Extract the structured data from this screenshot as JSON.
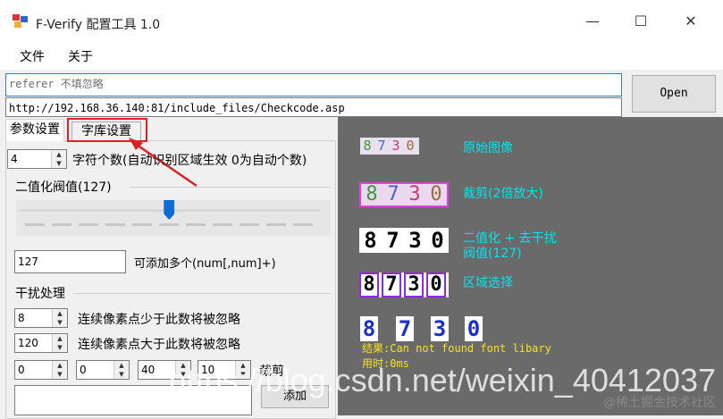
{
  "window": {
    "title": "F-Verify 配置工具 1.0",
    "min_glyph": "—",
    "max_glyph": "☐",
    "close_glyph": "✕"
  },
  "menu": {
    "items": [
      "文件",
      "关于"
    ]
  },
  "inputs": {
    "referer_value": "referer 不填忽略",
    "url_value": "http://192.168.36.140:81/include_files/Checkcode.asp",
    "open_label": "Open"
  },
  "tabs": [
    "参数设置",
    "字库设置"
  ],
  "params": {
    "char_count_value": "4",
    "char_count_label": "字符个数(自动识别区域生效 0为自动个数)",
    "binarize_group": "二值化阀值(127)",
    "threshold_value": 127,
    "threshold_text": "127",
    "threshold_hint": "可添加多个(num[,num]+)",
    "noise_group": "干扰处理",
    "min_pixels_value": "8",
    "min_pixels_label": "连续像素点少于此数将被忽略",
    "max_pixels_value": "120",
    "max_pixels_label": "连续像素点大于此数将被忽略",
    "crop": {
      "values": [
        "0",
        "0",
        "40",
        "10"
      ],
      "label": "裁剪"
    },
    "add_label": "添加"
  },
  "preview": {
    "digits": [
      "8",
      "7",
      "3",
      "0"
    ],
    "labels": {
      "original": "原始图像",
      "crop": "裁剪(2倍放大)",
      "binary_line1": "二值化 + 去干扰",
      "binary_line2": "阀值(127)",
      "region": "区域选择"
    },
    "result_line": "结果:Can not found font libary",
    "time_line": "用时:0ms"
  },
  "watermark": {
    "main": "https://blog.csdn.net/weixin_40412037",
    "small": "@稀土掘金技术社区"
  },
  "colors": {
    "canvas_bg": "#6a6a6a",
    "label_cyan": "#00e5ee",
    "result_yellow": "#f6e31c",
    "highlight_red": "#e02020",
    "slider_blue": "#0b6cd5"
  }
}
